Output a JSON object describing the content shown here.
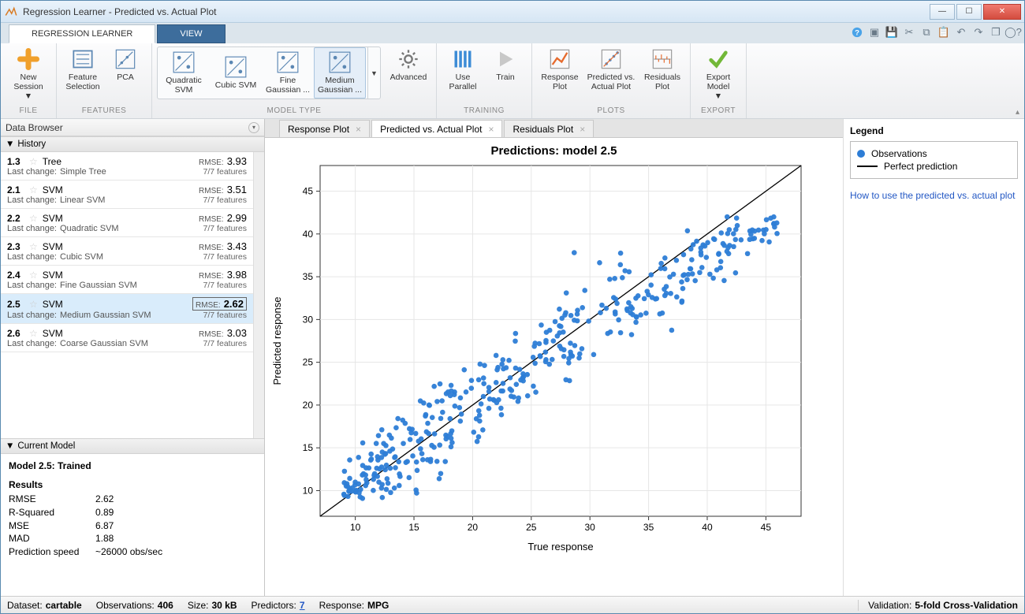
{
  "window": {
    "title": "Regression Learner - Predicted vs. Actual Plot"
  },
  "ribbon": {
    "tabs": [
      {
        "label": "REGRESSION LEARNER",
        "active": true
      },
      {
        "label": "VIEW",
        "active": false
      }
    ],
    "groups": {
      "file": {
        "label": "FILE",
        "new_session": "New\nSession"
      },
      "features": {
        "label": "FEATURES",
        "feature_selection": "Feature\nSelection",
        "pca": "PCA"
      },
      "model_type": {
        "label": "MODEL TYPE",
        "items": [
          {
            "label": "Quadratic\nSVM"
          },
          {
            "label": "Cubic SVM"
          },
          {
            "label": "Fine\nGaussian ..."
          },
          {
            "label": "Medium\nGaussian ...",
            "selected": true
          }
        ],
        "advanced": "Advanced"
      },
      "training": {
        "label": "TRAINING",
        "use_parallel": "Use\nParallel",
        "train": "Train"
      },
      "plots": {
        "label": "PLOTS",
        "response": "Response\nPlot",
        "predicted_vs_actual": "Predicted vs.\nActual Plot",
        "residuals": "Residuals\nPlot"
      },
      "export": {
        "label": "EXPORT",
        "export_model": "Export\nModel"
      }
    }
  },
  "data_browser": {
    "title": "Data Browser"
  },
  "history": {
    "title": "History",
    "last_change_label": "Last change:",
    "rmse_label": "RMSE:",
    "features_suffix": "7/7 features",
    "items": [
      {
        "idx": "1.3",
        "type": "Tree",
        "rmse": "3.93",
        "last_change": "Simple Tree"
      },
      {
        "idx": "2.1",
        "type": "SVM",
        "rmse": "3.51",
        "last_change": "Linear SVM"
      },
      {
        "idx": "2.2",
        "type": "SVM",
        "rmse": "2.99",
        "last_change": "Quadratic SVM"
      },
      {
        "idx": "2.3",
        "type": "SVM",
        "rmse": "3.43",
        "last_change": "Cubic SVM"
      },
      {
        "idx": "2.4",
        "type": "SVM",
        "rmse": "3.98",
        "last_change": "Fine Gaussian SVM"
      },
      {
        "idx": "2.5",
        "type": "SVM",
        "rmse": "2.62",
        "last_change": "Medium Gaussian SVM",
        "selected": true
      },
      {
        "idx": "2.6",
        "type": "SVM",
        "rmse": "3.03",
        "last_change": "Coarse Gaussian SVM"
      }
    ]
  },
  "current_model": {
    "title": "Current Model",
    "heading": "Model 2.5: Trained",
    "results_label": "Results",
    "metrics": [
      {
        "k": "RMSE",
        "v": "2.62"
      },
      {
        "k": "R-Squared",
        "v": "0.89"
      },
      {
        "k": "MSE",
        "v": "6.87"
      },
      {
        "k": "MAD",
        "v": "1.88"
      },
      {
        "k": "Prediction speed",
        "v": "~26000 obs/sec"
      }
    ]
  },
  "doc_tabs": [
    {
      "label": "Response Plot"
    },
    {
      "label": "Predicted vs. Actual Plot",
      "active": true
    },
    {
      "label": "Residuals Plot"
    }
  ],
  "legend": {
    "title": "Legend",
    "observations": "Observations",
    "perfect": "Perfect prediction"
  },
  "help_link": "How to use the predicted vs. actual plot",
  "status": {
    "dataset_label": "Dataset:",
    "dataset": "cartable",
    "obs_label": "Observations:",
    "obs": "406",
    "size_label": "Size:",
    "size": "30 kB",
    "predictors_label": "Predictors:",
    "predictors": "7",
    "response_label": "Response:",
    "response": "MPG",
    "validation_label": "Validation:",
    "validation": "5-fold Cross-Validation"
  },
  "chart_data": {
    "type": "scatter",
    "title": "Predictions: model 2.5",
    "xlabel": "True response",
    "ylabel": "Predicted response",
    "xlim": [
      7,
      48
    ],
    "ylim": [
      7,
      48
    ],
    "xticks": [
      10,
      15,
      20,
      25,
      30,
      35,
      40,
      45
    ],
    "yticks": [
      10,
      15,
      20,
      25,
      30,
      35,
      40,
      45
    ],
    "series": [
      {
        "name": "Observations",
        "color": "#2d7dd6"
      },
      {
        "name": "Perfect prediction",
        "type": "line",
        "x": [
          7,
          48
        ],
        "y": [
          7,
          48
        ],
        "color": "#000"
      }
    ],
    "note": "scatter points rendered synthetically along y≈x with σ≈2.62 (model RMSE)"
  }
}
